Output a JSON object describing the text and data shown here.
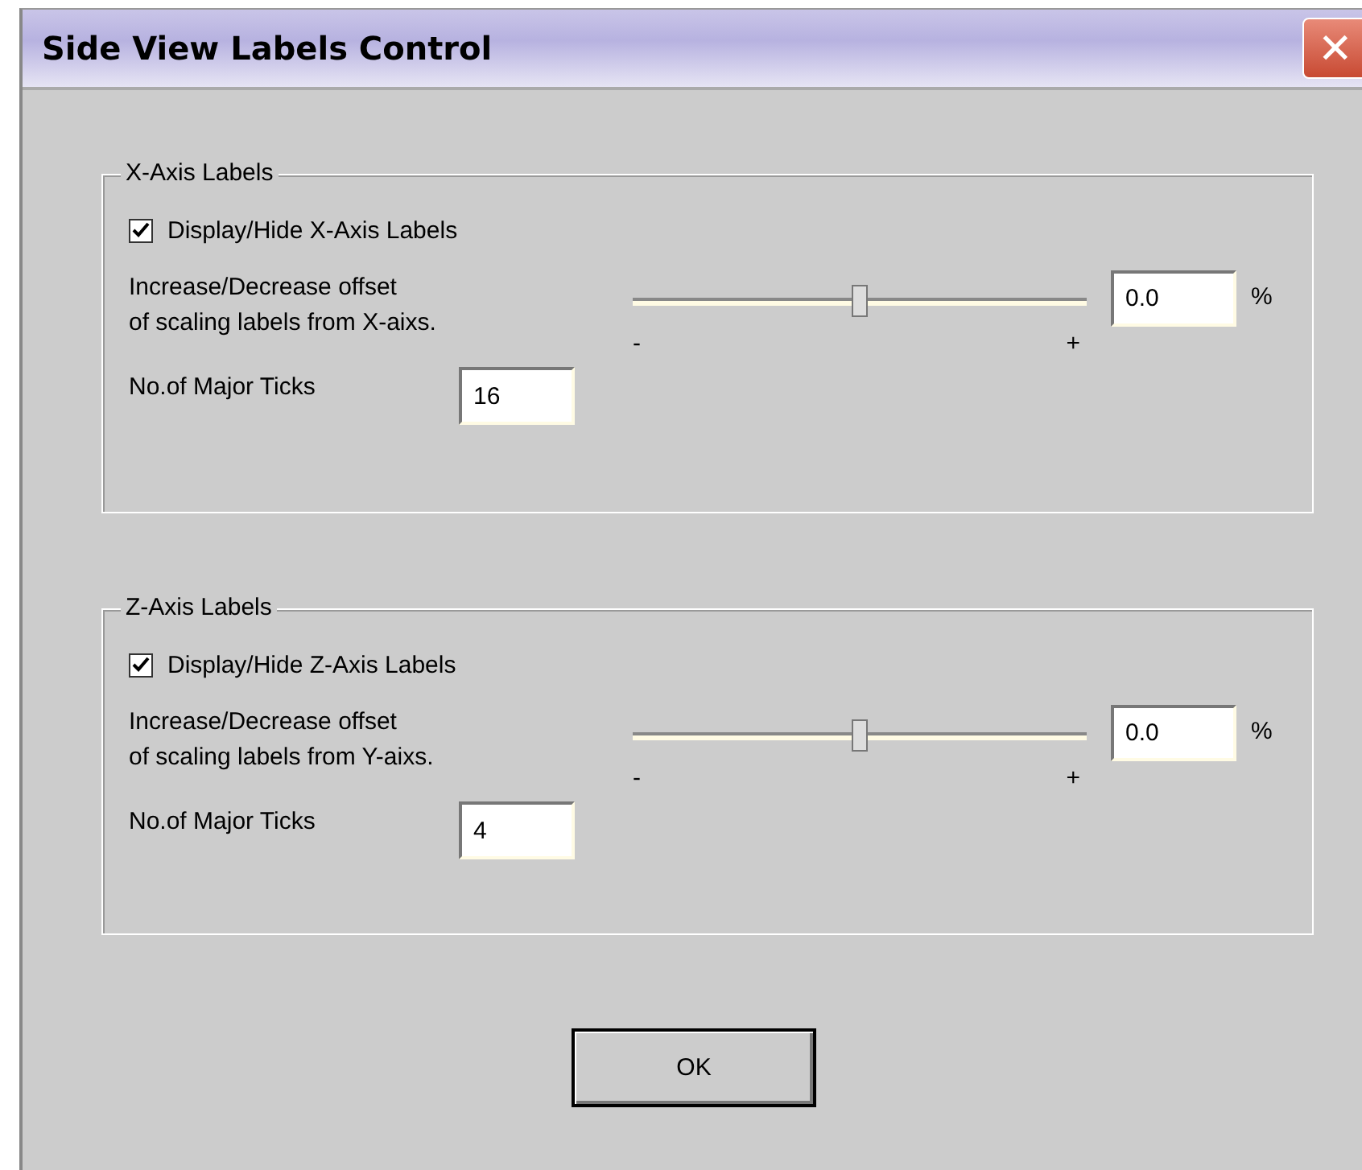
{
  "window": {
    "title": "Side View Labels Control",
    "close": "✕"
  },
  "groups": [
    {
      "title": "X-Axis Labels",
      "checkbox": {
        "label": "Display/Hide X-Axis Labels",
        "checked": true
      },
      "offset_label": "Increase/Decrease offset\nof scaling labels from X-aixs.",
      "slider": {
        "level": 0.5,
        "min_label": "-",
        "max_label": "+"
      },
      "offset_value": "0.0",
      "unit": "%",
      "ticks_label": "No.of Major Ticks",
      "ticks_value": "16"
    },
    {
      "title": "Z-Axis Labels",
      "checkbox": {
        "label": "Display/Hide Z-Axis Labels",
        "checked": true
      },
      "offset_label": "Increase/Decrease offset\nof scaling labels from Y-aixs.",
      "slider": {
        "level": 0.5,
        "min_label": "-",
        "max_label": "+"
      },
      "offset_value": "0.0",
      "unit": "%",
      "ticks_label": "No.of Major Ticks",
      "ticks_value": "4"
    }
  ],
  "buttons": [
    "OK"
  ]
}
